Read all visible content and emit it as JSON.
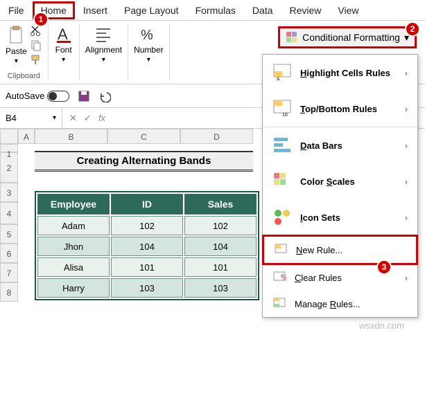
{
  "menu": {
    "items": [
      "File",
      "Home",
      "Insert",
      "Page Layout",
      "Formulas",
      "Data",
      "Review",
      "View"
    ],
    "active_index": 1
  },
  "ribbon": {
    "groups": [
      {
        "label": "Clipboard",
        "big_btn": "Paste"
      },
      {
        "label": "Font"
      },
      {
        "label": "Alignment"
      },
      {
        "label": "Number"
      }
    ],
    "cond_fmt_label": "Conditional Formatting"
  },
  "autosave": {
    "label": "AutoSave"
  },
  "formula_bar": {
    "name_box": "B4",
    "fx": "fx"
  },
  "columns": [
    "A",
    "B",
    "C",
    "D"
  ],
  "rows": [
    "1",
    "2",
    "3",
    "4",
    "5",
    "6",
    "7",
    "8"
  ],
  "title_banner": "Creating Alternating Bands",
  "table": {
    "headers": [
      "Employee",
      "ID",
      "Sales"
    ],
    "rows": [
      [
        "Adam",
        "102",
        "102"
      ],
      [
        "Jhon",
        "104",
        "104"
      ],
      [
        "Alisa",
        "101",
        "101"
      ],
      [
        "Harry",
        "103",
        "103"
      ]
    ]
  },
  "dropdown": {
    "items": [
      {
        "label": "Highlight Cells Rules",
        "key": "H",
        "bold": true,
        "arrow": true
      },
      {
        "label": "Top/Bottom Rules",
        "key": "T",
        "bold": true,
        "arrow": true
      },
      {
        "label": "Data Bars",
        "key": "D",
        "bold": true,
        "arrow": true
      },
      {
        "label": "Color Scales",
        "key": "S",
        "bold": true,
        "arrow": true
      },
      {
        "label": "Icon Sets",
        "key": "I",
        "bold": true,
        "arrow": true
      },
      {
        "label": "New Rule...",
        "key": "N",
        "highlighted": true
      },
      {
        "label": "Clear Rules",
        "key": "C",
        "arrow": true
      },
      {
        "label": "Manage Rules...",
        "key": "R"
      }
    ]
  },
  "badges": {
    "b1": "1",
    "b2": "2",
    "b3": "3"
  },
  "watermark": "wsxdn.com"
}
